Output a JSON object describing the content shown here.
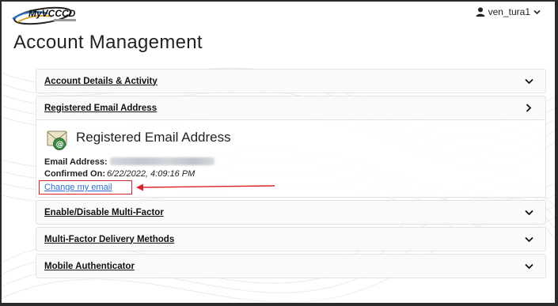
{
  "header": {
    "logo_text": "MyVCCCD",
    "user_name": "ven_tura1"
  },
  "page": {
    "title": "Account Management"
  },
  "accordion": [
    {
      "label": "Account Details & Activity",
      "state": "collapsed",
      "chevron": "chevron-down-icon"
    },
    {
      "label": "Registered Email Address",
      "state": "expanded",
      "chevron": "chevron-right-icon"
    },
    {
      "label": "Enable/Disable Multi-Factor",
      "state": "collapsed",
      "chevron": "chevron-down-icon"
    },
    {
      "label": "Multi-Factor Delivery Methods",
      "state": "collapsed",
      "chevron": "chevron-down-icon"
    },
    {
      "label": "Mobile Authenticator",
      "state": "collapsed",
      "chevron": "chevron-down-icon"
    }
  ],
  "email_panel": {
    "icon": "email-envelope-icon",
    "title": "Registered Email Address",
    "email_label": "Email Address:",
    "email_value": "",
    "confirmed_label": "Confirmed On:",
    "confirmed_value": "6/22/2022, 4:09:16 PM",
    "change_link": "Change my email"
  },
  "colors": {
    "highlight_box": "#d9232a",
    "link": "#2f6dd0",
    "annotation_arrow": "#d9232a"
  }
}
